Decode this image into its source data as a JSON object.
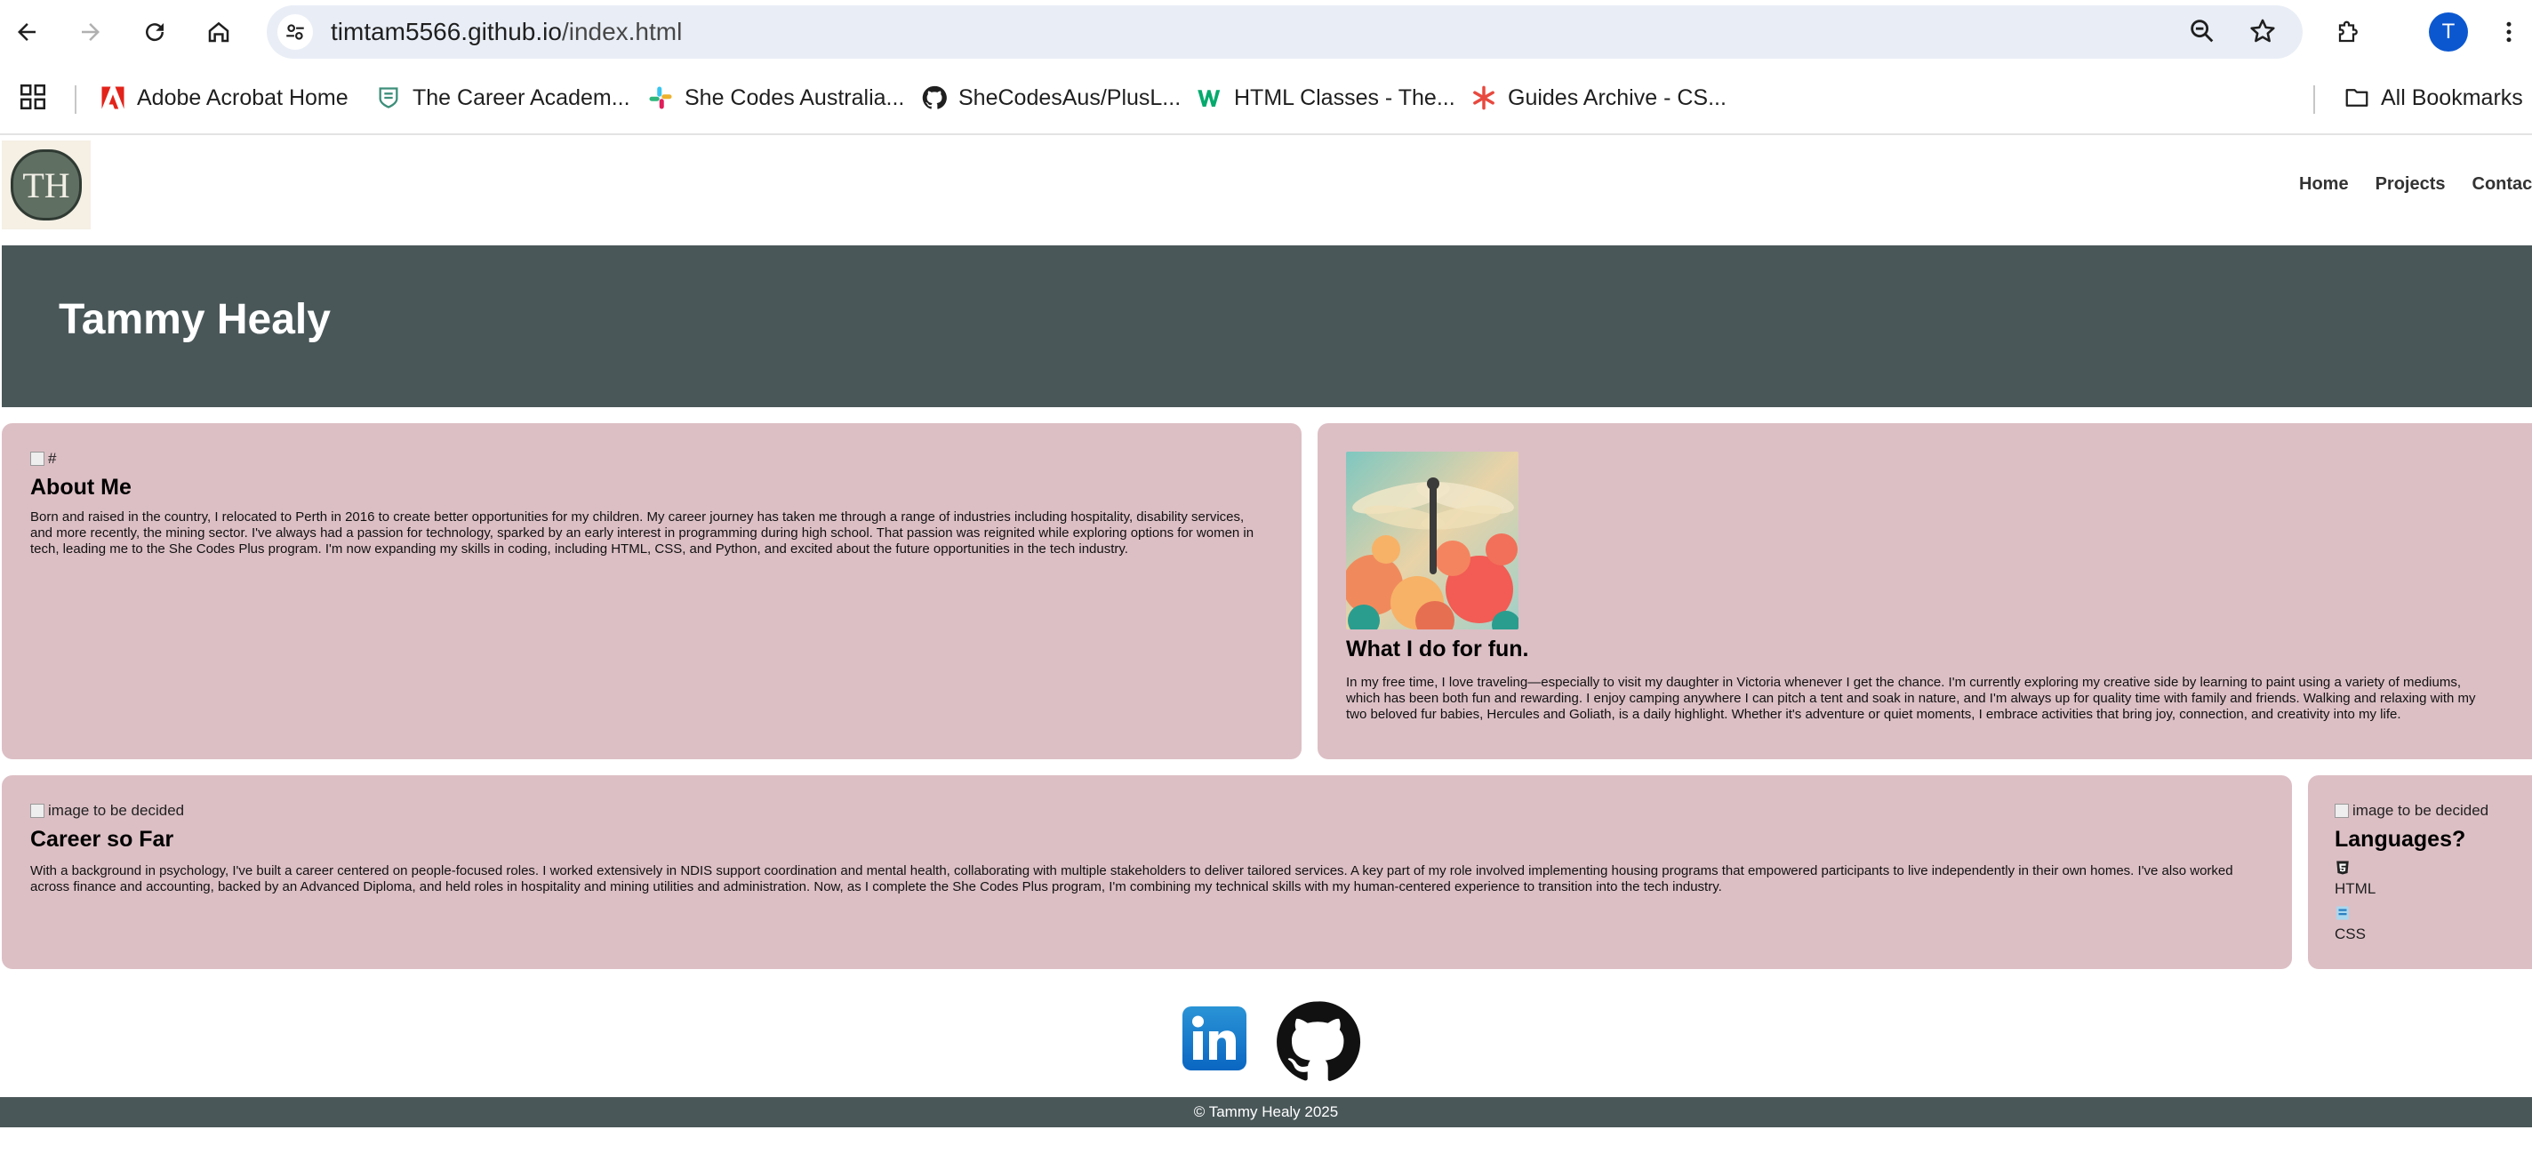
{
  "browser": {
    "url_host": "timtam5566.github.io",
    "url_path": "/index.html",
    "profile_initial": "T",
    "bookmarks": [
      {
        "label": "Adobe Acrobat Home",
        "icon": "adobe-icon"
      },
      {
        "label": "The Career Academ...",
        "icon": "career-academy-icon"
      },
      {
        "label": "She Codes Australia...",
        "icon": "slack-icon"
      },
      {
        "label": "SheCodesAus/PlusL...",
        "icon": "github-icon"
      },
      {
        "label": "HTML Classes - The...",
        "icon": "w3schools-icon"
      },
      {
        "label": "Guides Archive - CS...",
        "icon": "asterisk-icon"
      }
    ],
    "all_bookmarks": "All Bookmarks"
  },
  "site": {
    "logo_text": "TH",
    "nav": [
      "Home",
      "Projects",
      "Contact"
    ],
    "hero_title": "Tammy Healy",
    "about": {
      "img_alt": "#",
      "title": "About Me",
      "text": "Born and raised in the country, I relocated to Perth in 2016 to create better opportunities for my children. My career journey has taken me through a range of industries including hospitality, disability services, and more recently, the mining sector. I've always had a passion for technology, sparked by an early interest in programming during high school. That passion was reignited while exploring options for women in tech, leading me to the She Codes Plus program. I'm now expanding my skills in coding, including HTML, CSS, and Python, and excited about the future opportunities in the tech industry."
    },
    "fun": {
      "title": "What I do for fun.",
      "text": "In my free time, I love traveling—especially to visit my daughter in Victoria whenever I get the chance. I'm currently exploring my creative side by learning to paint using a variety of mediums, which has been both fun and rewarding. I enjoy camping anywhere I can pitch a tent and soak in nature, and I'm always up for quality time with family and friends. Walking and relaxing with my two beloved fur babies, Hercules and Goliath, is a daily highlight. Whether it's adventure or quiet moments, I embrace activities that bring joy, connection, and creativity into my life."
    },
    "career": {
      "img_alt": "image to be decided",
      "title": "Career so Far",
      "text": "With a background in psychology, I've built a career centered on people-focused roles. I worked extensively in NDIS support coordination and mental health, collaborating with multiple stakeholders to deliver tailored services. A key part of my role involved implementing housing programs that empowered participants to live independently in their own homes. I've also worked across finance and accounting, backed by an Advanced Diploma, and held roles in hospitality and mining utilities and administration. Now, as I complete the She Codes Plus program, I'm combining my technical skills with my human-centered experience to transition into the tech industry."
    },
    "languages": {
      "img_alt": "image to be decided",
      "title": "Languages?",
      "items": [
        "HTML",
        "CSS"
      ]
    },
    "footer": "© Tammy Healy 2025"
  }
}
